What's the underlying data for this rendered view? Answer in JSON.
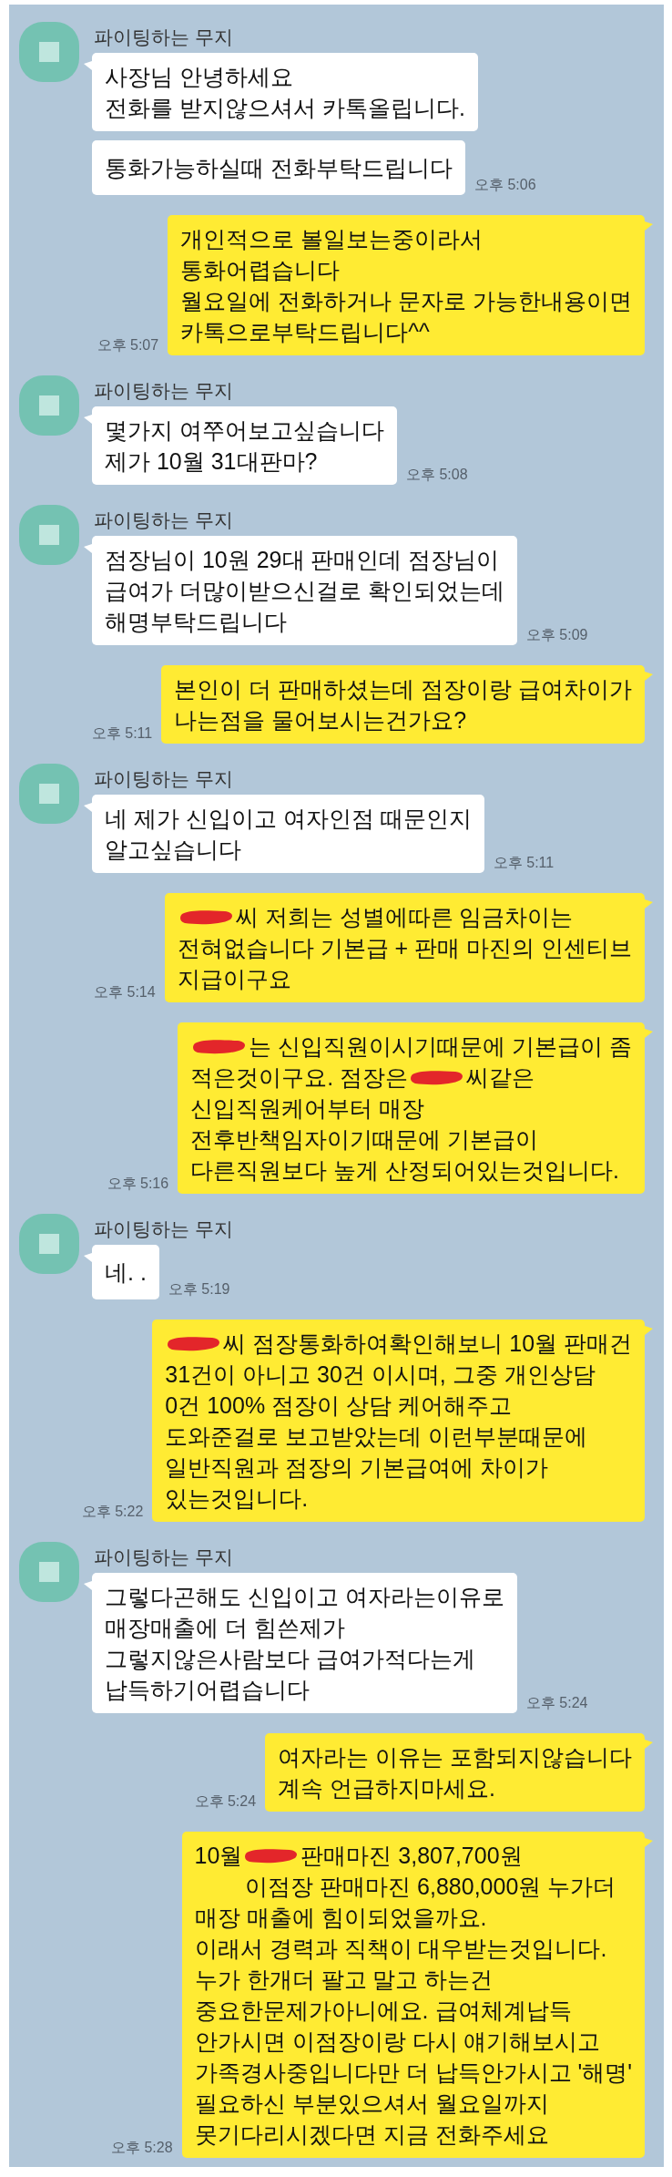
{
  "chat": {
    "messages": [
      {
        "kind": "incoming",
        "sender": "파이팅하는 무지",
        "bubbles": [
          {
            "lines": [
              "사장님 안녕하세요",
              "전화를 받지않으셔서 카톡올립니다."
            ]
          },
          {
            "lines": [
              "통화가능하실때 전화부탁드립니다"
            ]
          }
        ],
        "time": "오후 5:06"
      },
      {
        "kind": "outgoing",
        "bubbles": [
          {
            "lines": [
              "개인적으로 볼일보는중이라서",
              "통화어렵습니다",
              "월요일에 전화하거나 문자로 가능한내용이면",
              "카톡으로부탁드립니다^^"
            ]
          }
        ],
        "time": "오후 5:07"
      },
      {
        "kind": "incoming",
        "sender": "파이팅하는 무지",
        "bubbles": [
          {
            "lines": [
              "몇가지 여쭈어보고싶습니다",
              "제가 10월 31대판마?"
            ]
          }
        ],
        "time": "오후 5:08"
      },
      {
        "kind": "incoming",
        "sender": "파이팅하는 무지",
        "bubbles": [
          {
            "lines": [
              "점장님이 10원 29대 판매인데 점장님이",
              "급여가 더많이받으신걸로 확인되었는데",
              "해명부탁드립니다"
            ]
          }
        ],
        "time": "오후 5:09"
      },
      {
        "kind": "outgoing",
        "bubbles": [
          {
            "lines": [
              "본인이 더 판매하셨는데 점장이랑 급여차이가",
              "나는점을 물어보시는건가요?"
            ]
          }
        ],
        "time": "오후 5:11"
      },
      {
        "kind": "incoming",
        "sender": "파이팅하는 무지",
        "bubbles": [
          {
            "lines": [
              "네 제가 신입이고 여자인점 때문인지",
              "알고싶습니다"
            ]
          }
        ],
        "time": "오후 5:11"
      },
      {
        "kind": "outgoing",
        "bubbles": [
          {
            "lines": [
              {
                "parts": [
                  {
                    "kind": "redaction"
                  },
                  {
                    "kind": "text",
                    "text": "씨 저희는 성별에따른 임금차이는"
                  }
                ]
              },
              "전혀없습니다 기본급 + 판매 마진의 인센티브",
              "지급이구요"
            ]
          }
        ],
        "time": "오후 5:14"
      },
      {
        "kind": "outgoing",
        "bubbles": [
          {
            "lines": [
              {
                "parts": [
                  {
                    "kind": "redaction"
                  },
                  {
                    "kind": "text",
                    "text": "는 신입직원이시기때문에 기본급이 좀"
                  }
                ]
              },
              {
                "parts": [
                  {
                    "kind": "text",
                    "text": "적은것이구요. 점장은"
                  },
                  {
                    "kind": "redaction"
                  },
                  {
                    "kind": "text",
                    "text": "씨같은"
                  }
                ]
              },
              "신입직원케어부터 매장",
              "전후반책임자이기때문에 기본급이",
              "다른직원보다 높게 산정되어있는것입니다."
            ]
          }
        ],
        "time": "오후 5:16"
      },
      {
        "kind": "incoming",
        "sender": "파이팅하는 무지",
        "bubbles": [
          {
            "lines": [
              "네. ."
            ]
          }
        ],
        "time": "오후 5:19"
      },
      {
        "kind": "outgoing",
        "bubbles": [
          {
            "lines": [
              {
                "parts": [
                  {
                    "kind": "redaction"
                  },
                  {
                    "kind": "text",
                    "text": "씨 점장통화하여확인해보니 10월 판매건"
                  }
                ]
              },
              "31건이 아니고 30건 이시며, 그중 개인상담",
              "0건 100% 점장이 상담 케어해주고",
              "도와준걸로 보고받았는데 이런부분때문에",
              "일반직원과 점장의 기본급여에 차이가",
              "있는것입니다."
            ]
          }
        ],
        "time": "오후 5:22"
      },
      {
        "kind": "incoming",
        "sender": "파이팅하는 무지",
        "bubbles": [
          {
            "lines": [
              "그렇다곤해도 신입이고 여자라는이유로",
              "매장매출에 더 힘쓴제가",
              "그렇지않은사람보다 급여가적다는게",
              "납득하기어렵습니다"
            ]
          }
        ],
        "time": "오후 5:24"
      },
      {
        "kind": "outgoing",
        "bubbles": [
          {
            "lines": [
              "여자라는 이유는 포함되지않습니다",
              "계속 언급하지마세요."
            ]
          }
        ],
        "time": "오후 5:24"
      },
      {
        "kind": "outgoing",
        "bubbles": [
          {
            "lines": [
              {
                "parts": [
                  {
                    "kind": "text",
                    "text": "10월"
                  },
                  {
                    "kind": "redaction"
                  },
                  {
                    "kind": "text",
                    "text": "판매마진 3,807,700원"
                  }
                ]
              },
              "        이점장 판매마진 6,880,000원 누가더",
              "매장 매출에 힘이되었을까요.",
              "이래서 경력과 직책이 대우받는것입니다.",
              "누가 한개더 팔고 말고 하는건",
              "중요한문제가아니에요. 급여체계납득",
              "안가시면 이점장이랑 다시 얘기해보시고",
              "가족경사중입니다만 더 납득안가시고 '해명'",
              "필요하신 부분있으셔서 월요일까지",
              "못기다리시겠다면 지금 전화주세요"
            ]
          }
        ],
        "time": "오후 5:28"
      }
    ]
  }
}
